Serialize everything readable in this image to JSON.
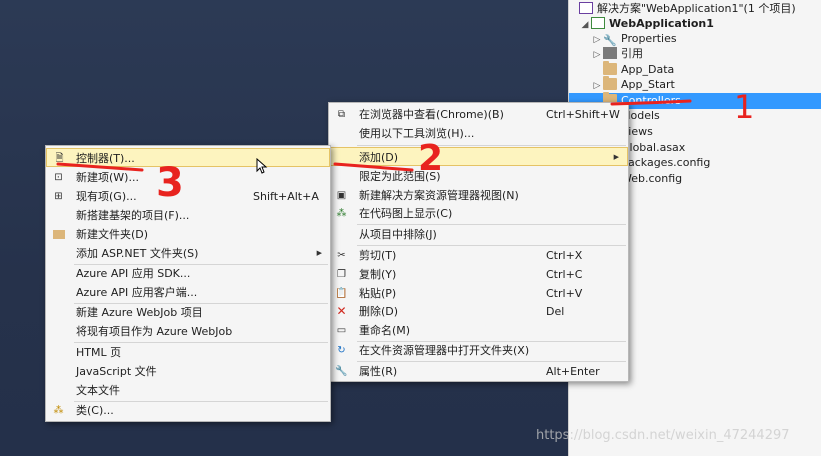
{
  "solution_explorer": {
    "solution_label": "解决方案\"WebApplication1\"(1 个项目)",
    "project_label": "WebApplication1",
    "items": [
      {
        "label": "Properties",
        "icon": "wrench-icon"
      },
      {
        "label": "引用",
        "icon": "references-icon"
      },
      {
        "label": "App_Data",
        "icon": "folder-icon"
      },
      {
        "label": "App_Start",
        "icon": "folder-icon"
      },
      {
        "label": "Controllers",
        "icon": "folder-icon",
        "selected": true
      },
      {
        "label": "Models",
        "icon": "folder-icon"
      },
      {
        "label": "Views",
        "icon": "folder-icon"
      },
      {
        "label": "Global.asax",
        "icon": "file-icon"
      },
      {
        "label": "packages.config",
        "icon": "file-icon"
      },
      {
        "label": "Web.config",
        "icon": "file-icon"
      }
    ]
  },
  "context_menu": {
    "items": [
      {
        "label": "在浏览器中查看(Chrome)(B)",
        "shortcut": "Ctrl+Shift+W",
        "icon": "browser-icon"
      },
      {
        "label": "使用以下工具浏览(H)...",
        "shortcut": "",
        "icon": ""
      },
      {
        "label": "添加(D)",
        "shortcut": "",
        "icon": "",
        "submenu": true,
        "hovered": true
      },
      {
        "label": "限定为此范围(S)",
        "shortcut": "",
        "icon": ""
      },
      {
        "label": "新建解决方案资源管理器视图(N)",
        "shortcut": "",
        "icon": "new-view-icon"
      },
      {
        "label": "在代码图上显示(C)",
        "shortcut": "",
        "icon": "code-map-icon"
      },
      {
        "label": "从项目中排除(J)",
        "shortcut": "",
        "icon": ""
      },
      {
        "label": "剪切(T)",
        "shortcut": "Ctrl+X",
        "icon": "scissors-icon"
      },
      {
        "label": "复制(Y)",
        "shortcut": "Ctrl+C",
        "icon": "copy-icon"
      },
      {
        "label": "粘贴(P)",
        "shortcut": "Ctrl+V",
        "icon": "paste-icon"
      },
      {
        "label": "删除(D)",
        "shortcut": "Del",
        "icon": "delete-icon"
      },
      {
        "label": "重命名(M)",
        "shortcut": "",
        "icon": "rename-icon"
      },
      {
        "label": "在文件资源管理器中打开文件夹(X)",
        "shortcut": "",
        "icon": "refresh-folder-icon"
      },
      {
        "label": "属性(R)",
        "shortcut": "Alt+Enter",
        "icon": "wrench-icon"
      }
    ]
  },
  "add_submenu": {
    "items": [
      {
        "label": "控制器(T)...",
        "shortcut": "",
        "icon": "controller-icon",
        "hovered": true
      },
      {
        "label": "新建项(W)...",
        "shortcut": "",
        "icon": "new-item-icon"
      },
      {
        "label": "现有项(G)...",
        "shortcut": "Shift+Alt+A",
        "icon": "existing-item-icon"
      },
      {
        "label": "新搭建基架的项目(F)...",
        "shortcut": "",
        "icon": ""
      },
      {
        "label": "新建文件夹(D)",
        "shortcut": "",
        "icon": "folder-icon"
      },
      {
        "label": "添加 ASP.NET 文件夹(S)",
        "shortcut": "",
        "icon": "",
        "submenu": true
      },
      {
        "label": "Azure API 应用 SDK...",
        "shortcut": "",
        "icon": ""
      },
      {
        "label": "Azure API 应用客户端...",
        "shortcut": "",
        "icon": ""
      },
      {
        "label": "新建 Azure WebJob 项目",
        "shortcut": "",
        "icon": ""
      },
      {
        "label": "将现有项目作为 Azure WebJob",
        "shortcut": "",
        "icon": ""
      },
      {
        "label": "HTML 页",
        "shortcut": "",
        "icon": ""
      },
      {
        "label": "JavaScript 文件",
        "shortcut": "",
        "icon": ""
      },
      {
        "label": "文本文件",
        "shortcut": "",
        "icon": ""
      },
      {
        "label": "类(C)...",
        "shortcut": "",
        "icon": "class-icon"
      }
    ]
  },
  "annotations": {
    "one": "1",
    "two": "2",
    "three": "3"
  },
  "watermark": "https://blog.csdn.net/weixin_47244297",
  "colors": {
    "selection": "#3399ff",
    "annotation": "#e8231f",
    "menu_hover": "#fdf4bf"
  }
}
